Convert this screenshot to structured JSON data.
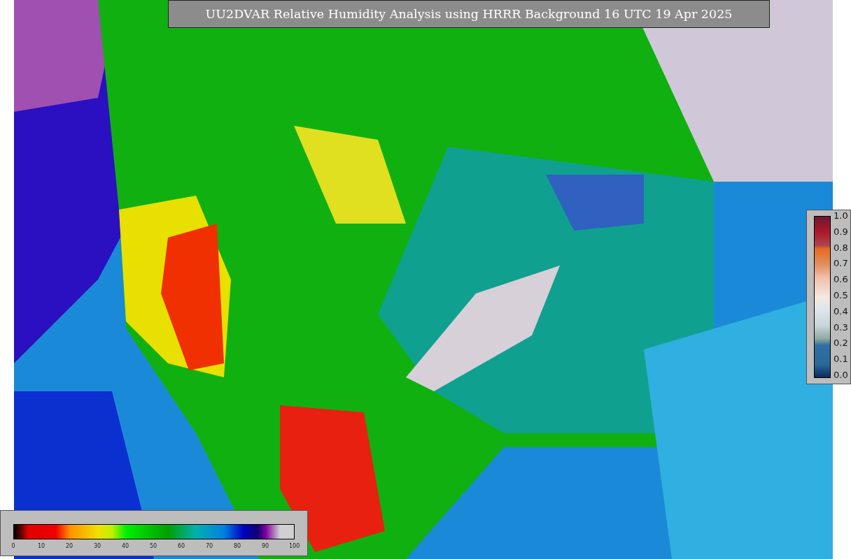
{
  "title": "UU2DVAR Relative Humidity Analysis using HRRR Background 16 UTC 19 Apr 2025",
  "observation_scale": {
    "ticks": [
      "1.0",
      "0.9",
      "0.8",
      "0.7",
      "0.6",
      "0.5",
      "0.4",
      "0.3",
      "0.2",
      "0.1",
      "0.0"
    ]
  },
  "humidity_scale": {
    "ticks": [
      "0",
      "10",
      "20",
      "30",
      "40",
      "50",
      "60",
      "70",
      "80",
      "90",
      "100"
    ]
  }
}
